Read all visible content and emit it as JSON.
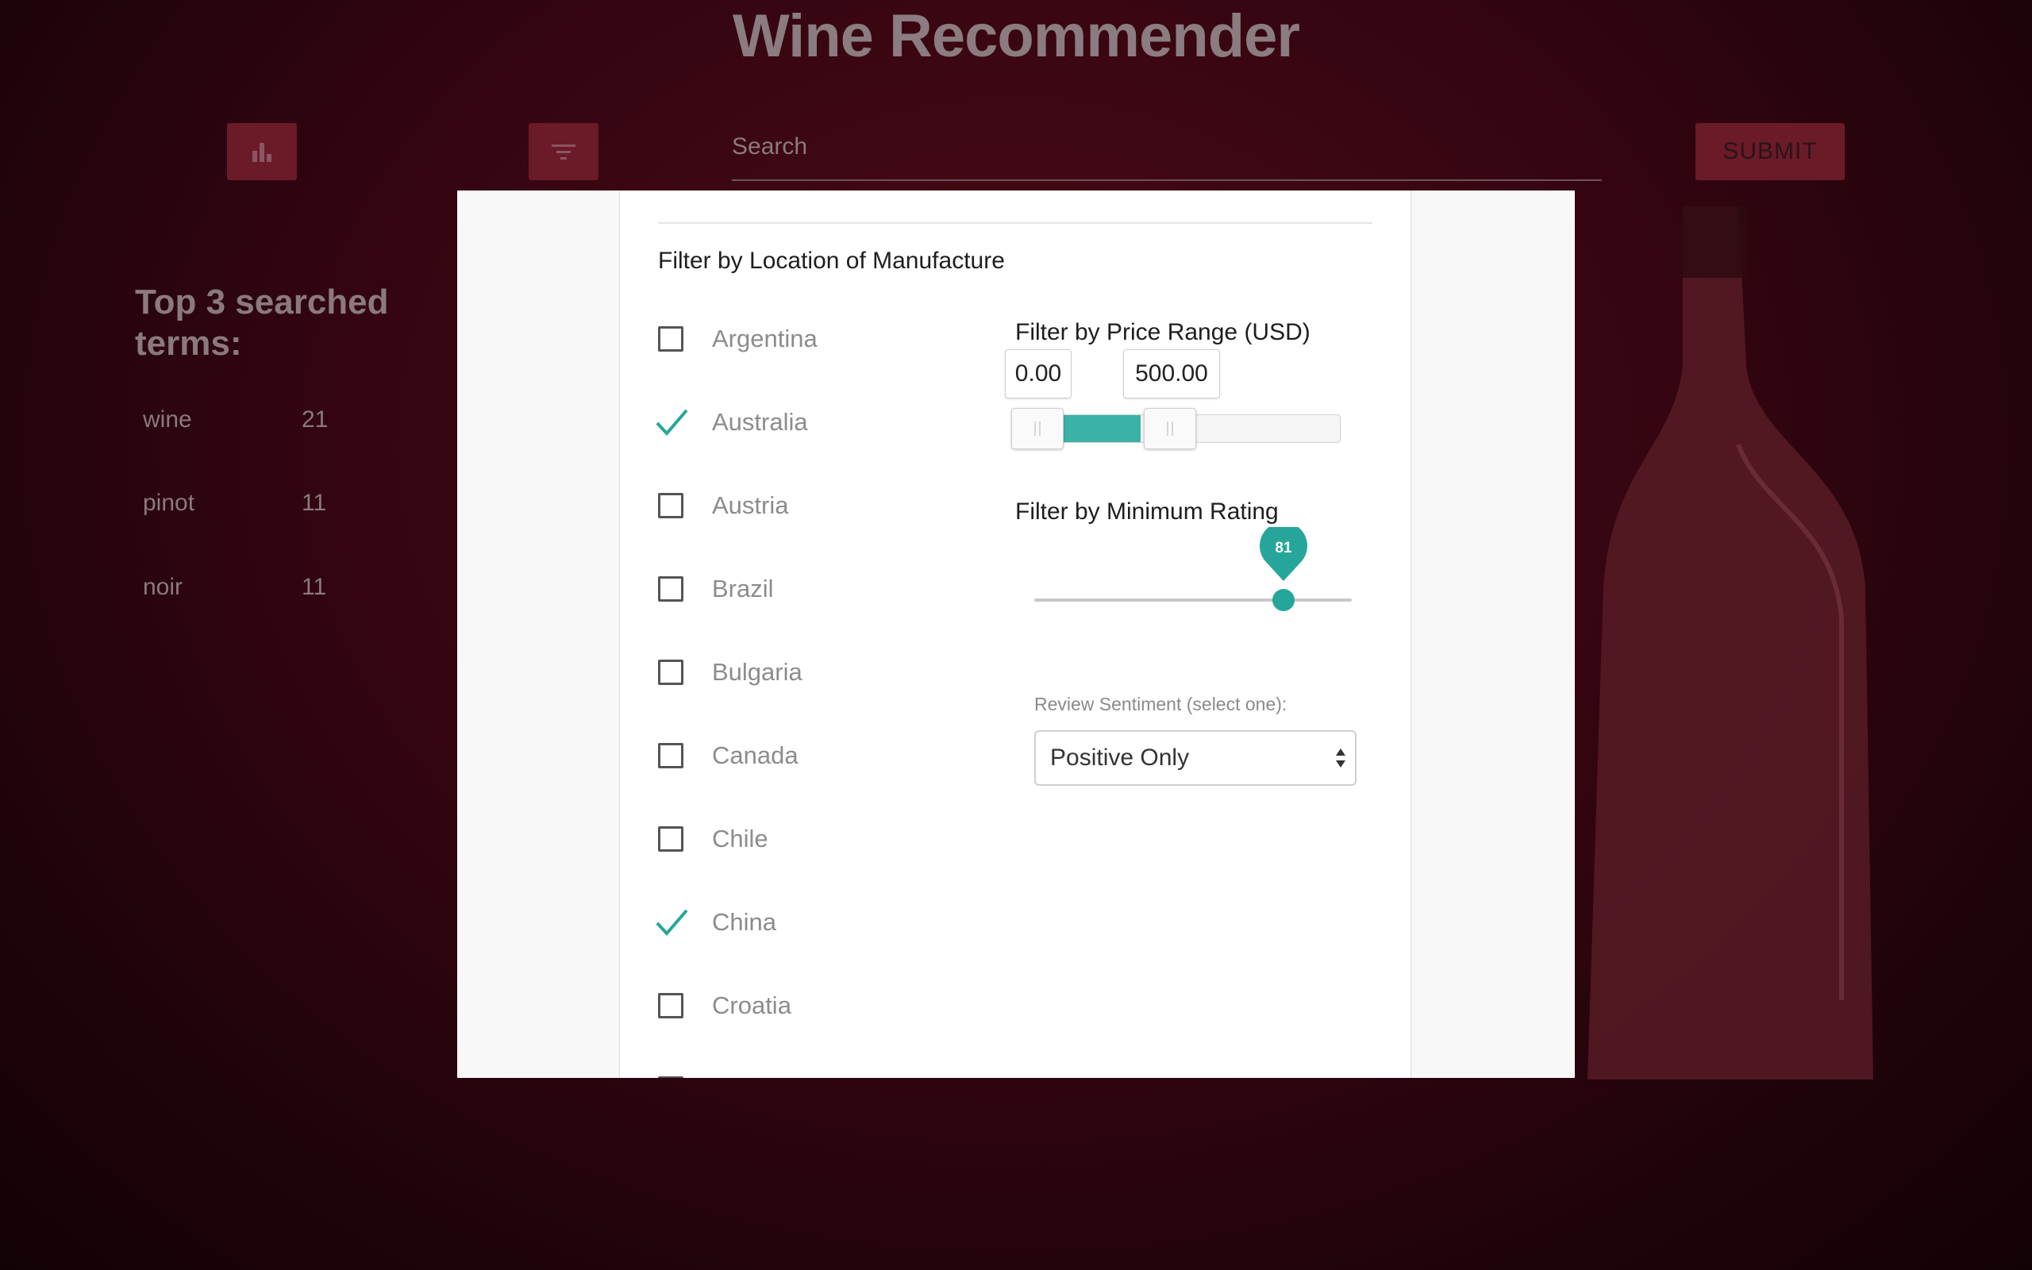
{
  "app": {
    "title": "Wine Recommender"
  },
  "toolbar": {
    "stats_icon": "bar-chart-icon",
    "filter_icon": "filter-icon",
    "search_placeholder": "Search",
    "submit_label": "SUBMIT"
  },
  "sidebar": {
    "title": "Top 3 searched terms:",
    "terms": [
      {
        "term": "wine",
        "count": "21"
      },
      {
        "term": "pinot",
        "count": "11"
      },
      {
        "term": "noir",
        "count": "11"
      }
    ]
  },
  "modal": {
    "location_title": "Filter by Location of Manufacture",
    "countries": [
      {
        "label": "Argentina",
        "checked": false
      },
      {
        "label": "Australia",
        "checked": true
      },
      {
        "label": "Austria",
        "checked": false
      },
      {
        "label": "Brazil",
        "checked": false
      },
      {
        "label": "Bulgaria",
        "checked": false
      },
      {
        "label": "Canada",
        "checked": false
      },
      {
        "label": "Chile",
        "checked": false
      },
      {
        "label": "China",
        "checked": true
      },
      {
        "label": "Croatia",
        "checked": false
      }
    ],
    "price": {
      "title": "Filter by Price Range (USD)",
      "min": "0.00",
      "max": "500.00"
    },
    "rating": {
      "title": "Filter by Minimum Rating",
      "value": "81"
    },
    "sentiment": {
      "label": "Review Sentiment (select one):",
      "selected": "Positive Only"
    }
  },
  "colors": {
    "accent": "#26a69a",
    "background": "#4a0818",
    "button": "#6b1a28"
  }
}
